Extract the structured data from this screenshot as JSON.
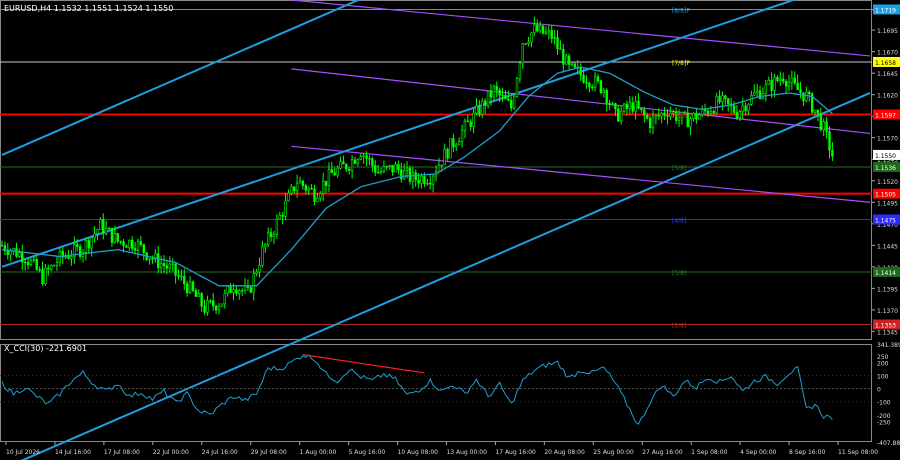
{
  "window": {
    "title": "EURUSD,H4  1.1532 1.1551 1.1524 1.1550",
    "cci_title": "X_CCI(30) -221.6901"
  },
  "colors": {
    "background": "#000000",
    "candle_bull": "#00ff00",
    "candle_bear": "#00ff00",
    "ma": "#1e9fcb",
    "channel_blue": "#1e9fe0",
    "channel_purple": "#a64dff",
    "level_red": "#ff0000",
    "cci_line": "#1e9fcb",
    "cci_div": "#ff2020",
    "grid": "#333333"
  },
  "chart_data": [
    {
      "type": "candlestick",
      "title": "EURUSD,H4  1.1532 1.1551 1.1524 1.1550",
      "ylim": [
        1.1335,
        1.173
      ],
      "y_ticks": [
        "1.1719",
        "1.1695",
        "1.1670",
        "1.1645",
        "1.1620",
        "1.1595",
        "1.1570",
        "1.1545",
        "1.1520",
        "1.1495",
        "1.1470",
        "1.1445",
        "1.1420",
        "1.1395",
        "1.1370",
        "1.1345"
      ],
      "x_ticks": [
        "10 Jul 2026",
        "14 Jul 16:00",
        "17 Jul 08:00",
        "22 Jul 00:00",
        "24 Jul 16:00",
        "29 Jul 08:00",
        "1 Aug 00:00",
        "5 Aug 16:00",
        "10 Aug 08:00",
        "13 Aug 00:00",
        "17 Aug 16:00",
        "20 Aug 08:00",
        "25 Aug 00:00",
        "27 Aug 16:00",
        "1 Sep 08:00",
        "4 Sep 00:00",
        "8 Sep 16:00",
        "11 Sep 08:00"
      ],
      "close_path": [
        [
          0,
          1.1445
        ],
        [
          8,
          1.1432
        ],
        [
          14,
          1.1408
        ],
        [
          20,
          1.143
        ],
        [
          28,
          1.1442
        ],
        [
          34,
          1.1468
        ],
        [
          40,
          1.145
        ],
        [
          46,
          1.1448
        ],
        [
          52,
          1.143
        ],
        [
          58,
          1.1418
        ],
        [
          64,
          1.1398
        ],
        [
          70,
          1.1372
        ],
        [
          76,
          1.138
        ],
        [
          80,
          1.14
        ],
        [
          85,
          1.1388
        ],
        [
          90,
          1.1438
        ],
        [
          96,
          1.1478
        ],
        [
          102,
          1.152
        ],
        [
          108,
          1.1505
        ],
        [
          114,
          1.1528
        ],
        [
          120,
          1.154
        ],
        [
          124,
          1.1555
        ],
        [
          130,
          1.153
        ],
        [
          136,
          1.1535
        ],
        [
          142,
          1.1522
        ],
        [
          148,
          1.1525
        ],
        [
          155,
          1.156
        ],
        [
          163,
          1.1594
        ],
        [
          170,
          1.1625
        ],
        [
          176,
          1.1605
        ],
        [
          180,
          1.1682
        ],
        [
          184,
          1.1695
        ],
        [
          190,
          1.1688
        ],
        [
          196,
          1.165
        ],
        [
          202,
          1.164
        ],
        [
          208,
          1.1627
        ],
        [
          212,
          1.1595
        ],
        [
          218,
          1.1608
        ],
        [
          224,
          1.1588
        ],
        [
          230,
          1.1602
        ],
        [
          236,
          1.159
        ],
        [
          242,
          1.1598
        ],
        [
          248,
          1.1612
        ],
        [
          254,
          1.16
        ],
        [
          260,
          1.162
        ],
        [
          266,
          1.1632
        ],
        [
          270,
          1.1642
        ],
        [
          274,
          1.1628
        ],
        [
          278,
          1.1618
        ],
        [
          281,
          1.1602
        ],
        [
          284,
          1.158
        ],
        [
          287,
          1.155
        ]
      ],
      "ma_path": [
        [
          0,
          1.144
        ],
        [
          20,
          1.1432
        ],
        [
          40,
          1.144
        ],
        [
          60,
          1.1425
        ],
        [
          75,
          1.1398
        ],
        [
          88,
          1.1398
        ],
        [
          100,
          1.144
        ],
        [
          112,
          1.1488
        ],
        [
          124,
          1.1513
        ],
        [
          138,
          1.1525
        ],
        [
          150,
          1.1528
        ],
        [
          160,
          1.1548
        ],
        [
          172,
          1.1578
        ],
        [
          182,
          1.1618
        ],
        [
          192,
          1.1645
        ],
        [
          200,
          1.1652
        ],
        [
          210,
          1.1645
        ],
        [
          222,
          1.1623
        ],
        [
          232,
          1.1608
        ],
        [
          242,
          1.1603
        ],
        [
          252,
          1.1608
        ],
        [
          262,
          1.1618
        ],
        [
          272,
          1.1622
        ],
        [
          280,
          1.1618
        ],
        [
          287,
          1.1598
        ]
      ],
      "level_labels": [
        {
          "text": "1.1719",
          "price": 1.1719,
          "role": "mm-8-8"
        },
        {
          "text": "1.1658",
          "price": 1.1658,
          "role": "line-yellow"
        },
        {
          "text": "1.1597",
          "price": 1.1597,
          "role": "red-resistance"
        },
        {
          "text": "1.1550",
          "price": 1.155,
          "role": "current"
        },
        {
          "text": "1.1536",
          "price": 1.1536,
          "role": "bid"
        },
        {
          "text": "1.1505",
          "price": 1.1505,
          "role": "red-support"
        },
        {
          "text": "1.1475",
          "price": 1.1475,
          "role": "mm-4-8"
        },
        {
          "text": "1.1414",
          "price": 1.1414,
          "role": "mm-3-8"
        },
        {
          "text": "1.1353",
          "price": 1.1353,
          "role": "mm-2-8"
        }
      ],
      "murrey_labels": [
        {
          "text": "[8/8]P",
          "price": 1.1719
        },
        {
          "text": "[7/8]P",
          "price": 1.1658
        },
        {
          "text": "[6/8]",
          "price": 1.1597
        },
        {
          "text": "[5/8]",
          "price": 1.1536
        },
        {
          "text": "[4/8]",
          "price": 1.1475
        },
        {
          "text": "[3/8]",
          "price": 1.1414
        },
        {
          "text": "[2/8]",
          "price": 1.1353
        }
      ],
      "horizontal_lines": [
        {
          "price": 1.1719,
          "color": "#888888"
        },
        {
          "price": 1.1658,
          "color": "#cccccc"
        },
        {
          "price": 1.1597,
          "color": "#ff0000",
          "width": 2
        },
        {
          "price": 1.1536,
          "color": "#2a6a2a"
        },
        {
          "price": 1.1505,
          "color": "#ff0000",
          "width": 2
        },
        {
          "price": 1.1475,
          "color": "#2a2aff"
        },
        {
          "price": 1.1414,
          "color": "#2a6a2a"
        },
        {
          "price": 1.1353,
          "color": "#aa2a2a"
        }
      ],
      "trend_lines": [
        {
          "color": "#1e9fe0",
          "from": [
            0,
            1.155
          ],
          "to": [
            130,
            1.174
          ]
        },
        {
          "color": "#1e9fe0",
          "from": [
            0,
            1.142
          ],
          "to": [
            300,
            1.176
          ]
        },
        {
          "color": "#1e9fe0",
          "from": [
            0,
            1.1185
          ],
          "to": [
            300,
            1.1622
          ]
        },
        {
          "color": "#a64dff",
          "from": [
            100,
            1.173
          ],
          "to": [
            300,
            1.1665
          ]
        },
        {
          "color": "#a64dff",
          "from": [
            100,
            1.165
          ],
          "to": [
            300,
            1.1575
          ]
        },
        {
          "color": "#a64dff",
          "from": [
            100,
            1.156
          ],
          "to": [
            300,
            1.1495
          ]
        }
      ]
    },
    {
      "type": "line",
      "title": "X_CCI(30) -221.6901",
      "ylim": [
        -407.8882,
        341.3899
      ],
      "y_ticks": [
        "341.3899",
        "250",
        "200",
        "100",
        "0",
        "-100",
        "-200",
        "-250",
        "-407.888"
      ],
      "values": [
        [
          0,
          40
        ],
        [
          4,
          -40
        ],
        [
          8,
          10
        ],
        [
          12,
          -60
        ],
        [
          16,
          -120
        ],
        [
          20,
          -40
        ],
        [
          24,
          60
        ],
        [
          28,
          120
        ],
        [
          32,
          30
        ],
        [
          36,
          -20
        ],
        [
          40,
          40
        ],
        [
          44,
          -60
        ],
        [
          48,
          -30
        ],
        [
          52,
          -80
        ],
        [
          56,
          -20
        ],
        [
          60,
          -110
        ],
        [
          64,
          -40
        ],
        [
          68,
          -170
        ],
        [
          72,
          -200
        ],
        [
          76,
          -120
        ],
        [
          80,
          -60
        ],
        [
          84,
          -90
        ],
        [
          88,
          -40
        ],
        [
          92,
          160
        ],
        [
          96,
          150
        ],
        [
          100,
          200
        ],
        [
          104,
          260
        ],
        [
          108,
          230
        ],
        [
          112,
          110
        ],
        [
          116,
          60
        ],
        [
          120,
          150
        ],
        [
          124,
          90
        ],
        [
          128,
          60
        ],
        [
          132,
          110
        ],
        [
          136,
          70
        ],
        [
          140,
          -50
        ],
        [
          144,
          -10
        ],
        [
          148,
          60
        ],
        [
          152,
          -20
        ],
        [
          156,
          30
        ],
        [
          160,
          -40
        ],
        [
          164,
          70
        ],
        [
          168,
          -60
        ],
        [
          172,
          30
        ],
        [
          176,
          -120
        ],
        [
          180,
          60
        ],
        [
          184,
          140
        ],
        [
          188,
          180
        ],
        [
          192,
          200
        ],
        [
          196,
          80
        ],
        [
          200,
          140
        ],
        [
          204,
          120
        ],
        [
          208,
          160
        ],
        [
          212,
          40
        ],
        [
          216,
          -120
        ],
        [
          220,
          -280
        ],
        [
          224,
          -100
        ],
        [
          228,
          30
        ],
        [
          232,
          -60
        ],
        [
          236,
          60
        ],
        [
          240,
          10
        ],
        [
          244,
          90
        ],
        [
          248,
          50
        ],
        [
          252,
          100
        ],
        [
          256,
          -20
        ],
        [
          260,
          60
        ],
        [
          264,
          90
        ],
        [
          268,
          40
        ],
        [
          272,
          120
        ],
        [
          275,
          150
        ],
        [
          278,
          -160
        ],
        [
          281,
          -120
        ],
        [
          284,
          -210
        ],
        [
          287,
          -222
        ]
      ],
      "divergence": {
        "from": [
          104,
          260
        ],
        "to": [
          146,
          120
        ],
        "color": "#ff2020"
      }
    }
  ]
}
